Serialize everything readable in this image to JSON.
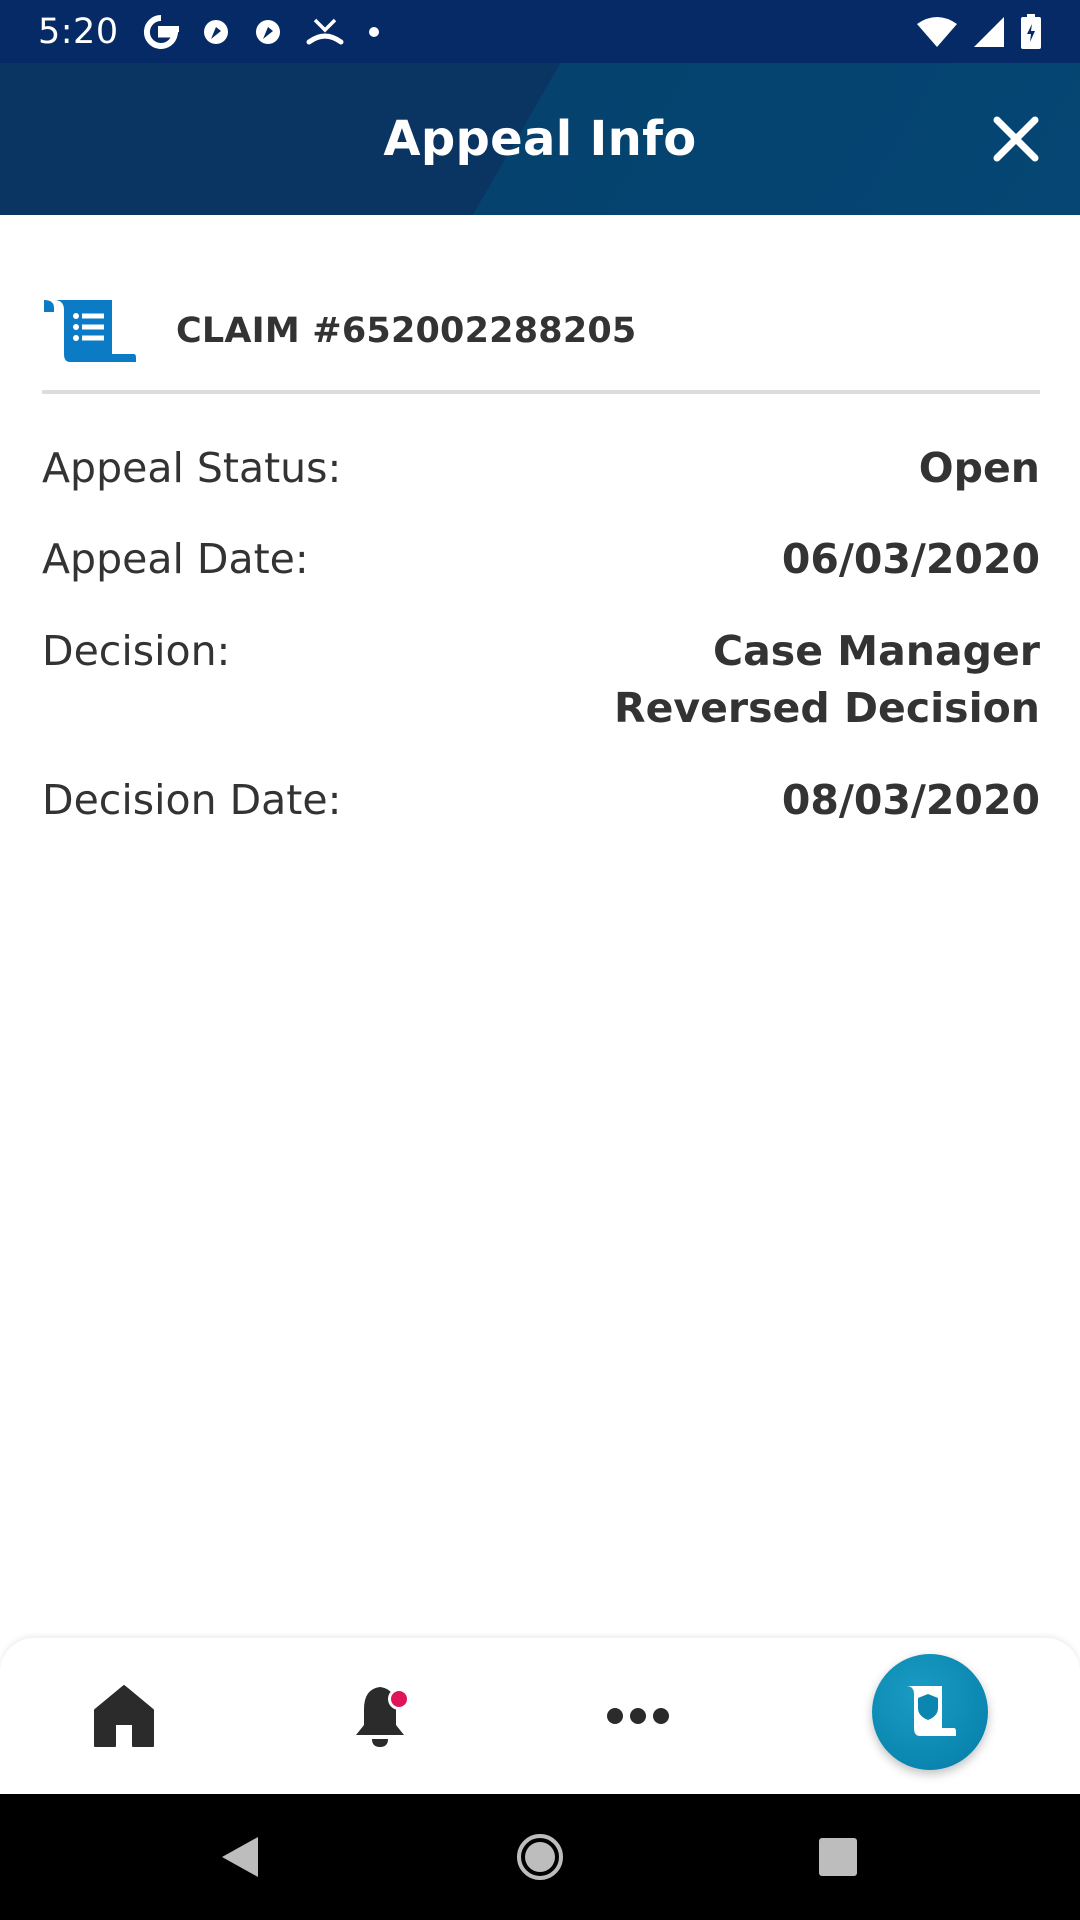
{
  "status_bar": {
    "time": "5:20",
    "left_icons": [
      "google-icon",
      "app-icon",
      "app-icon",
      "missed-call-icon",
      "dot-icon"
    ],
    "right_icons": [
      "wifi-icon",
      "signal-icon",
      "battery-icon"
    ]
  },
  "header": {
    "title": "Appeal Info",
    "close_icon": "close-icon",
    "colors": {
      "dark": "#0a3563",
      "light": "#054674"
    }
  },
  "claim": {
    "icon": "scroll-list-icon",
    "title": "CLAIM #652002288205",
    "icon_color": "#0a7bc4"
  },
  "appeal_details": [
    {
      "label": "Appeal Status:",
      "value": "Open"
    },
    {
      "label": "Appeal Date:",
      "value": "06/03/2020"
    },
    {
      "label": "Decision:",
      "value": "Case Manager Reversed Decision"
    },
    {
      "label": "Decision Date:",
      "value": "08/03/2020"
    }
  ],
  "bottom_nav": {
    "items": [
      {
        "name": "home",
        "icon": "home-icon"
      },
      {
        "name": "notifications",
        "icon": "bell-icon",
        "has_badge": true
      },
      {
        "name": "more",
        "icon": "more-dots-icon"
      },
      {
        "name": "id-card",
        "icon": "shield-card-icon"
      }
    ],
    "badge_color": "#e0145a",
    "accent_color": "#0a86b0"
  },
  "system_nav": [
    "back-icon",
    "home-circle-icon",
    "recents-icon"
  ]
}
